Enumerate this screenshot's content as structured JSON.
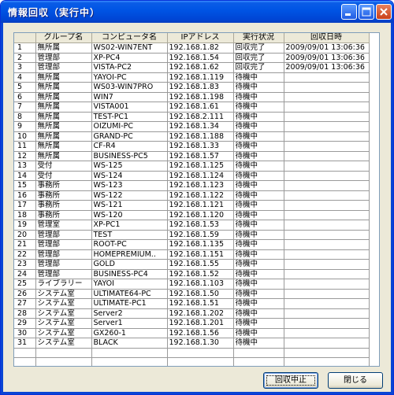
{
  "window": {
    "title": "情報回収（実行中）"
  },
  "table": {
    "columns": [
      "",
      "グループ名",
      "コンピュータ名",
      "IPアドレス",
      "実行状況",
      "回収日時"
    ],
    "rows": [
      [
        "1",
        "無所属",
        "WS02-WIN7ENT",
        "192.168.1.82",
        "回収完了",
        "2009/09/01 13:06:36"
      ],
      [
        "2",
        "管理部",
        "XP-PC4",
        "192.168.1.54",
        "回収完了",
        "2009/09/01 13:06:36"
      ],
      [
        "3",
        "管理部",
        "VISTA-PC2",
        "192.168.1.62",
        "回収完了",
        "2009/09/01 13:06:36"
      ],
      [
        "4",
        "無所属",
        "YAYOI-PC",
        "192.168.1.119",
        "待機中",
        ""
      ],
      [
        "5",
        "無所属",
        "WS03-WIN7PRO",
        "192.168.1.83",
        "待機中",
        ""
      ],
      [
        "6",
        "無所属",
        "WIN7",
        "192.168.1.198",
        "待機中",
        ""
      ],
      [
        "7",
        "無所属",
        "VISTA001",
        "192.168.1.61",
        "待機中",
        ""
      ],
      [
        "8",
        "無所属",
        "TEST-PC1",
        "192.168.2.111",
        "待機中",
        ""
      ],
      [
        "9",
        "無所属",
        "OIZUMI-PC",
        "192.168.1.34",
        "待機中",
        ""
      ],
      [
        "10",
        "無所属",
        "GRAND-PC",
        "192.168.1.188",
        "待機中",
        ""
      ],
      [
        "11",
        "無所属",
        "CF-R4",
        "192.168.1.33",
        "待機中",
        ""
      ],
      [
        "12",
        "無所属",
        "BUSINESS-PC5",
        "192.168.1.57",
        "待機中",
        ""
      ],
      [
        "13",
        "受付",
        "WS-125",
        "192.168.1.125",
        "待機中",
        ""
      ],
      [
        "14",
        "受付",
        "WS-124",
        "192.168.1.124",
        "待機中",
        ""
      ],
      [
        "15",
        "事務所",
        "WS-123",
        "192.168.1.123",
        "待機中",
        ""
      ],
      [
        "16",
        "事務所",
        "WS-122",
        "192.168.1.122",
        "待機中",
        ""
      ],
      [
        "17",
        "事務所",
        "WS-121",
        "192.168.1.121",
        "待機中",
        ""
      ],
      [
        "18",
        "事務所",
        "WS-120",
        "192.168.1.120",
        "待機中",
        ""
      ],
      [
        "19",
        "管理室",
        "XP-PC1",
        "192.168.1.53",
        "待機中",
        ""
      ],
      [
        "20",
        "管理部",
        "TEST",
        "192.168.1.59",
        "待機中",
        ""
      ],
      [
        "21",
        "管理部",
        "ROOT-PC",
        "192.168.1.135",
        "待機中",
        ""
      ],
      [
        "22",
        "管理部",
        "HOMEPREMIUM..",
        "192.168.1.151",
        "待機中",
        ""
      ],
      [
        "23",
        "管理部",
        "GOLD",
        "192.168.1.55",
        "待機中",
        ""
      ],
      [
        "24",
        "管理部",
        "BUSINESS-PC4",
        "192.168.1.52",
        "待機中",
        ""
      ],
      [
        "25",
        "ライブラリー",
        "YAYOI",
        "192.168.1.103",
        "待機中",
        ""
      ],
      [
        "26",
        "システム室",
        "ULTIMATE64-PC",
        "192.168.1.50",
        "待機中",
        ""
      ],
      [
        "27",
        "システム室",
        "ULTIMATE-PC1",
        "192.168.1.51",
        "待機中",
        ""
      ],
      [
        "28",
        "システム室",
        "Server2",
        "192.168.1.202",
        "待機中",
        ""
      ],
      [
        "29",
        "システム室",
        "Server1",
        "192.168.1.201",
        "待機中",
        ""
      ],
      [
        "30",
        "システム室",
        "GX260-1",
        "192.168.1.56",
        "待機中",
        ""
      ],
      [
        "31",
        "システム室",
        "BLACK",
        "192.168.1.30",
        "待機中",
        ""
      ]
    ]
  },
  "buttons": {
    "stop": "回収中止",
    "close": "閉じる"
  },
  "icons": {
    "minimize": "minimize-icon",
    "maximize": "maximize-icon",
    "close": "close-icon"
  }
}
